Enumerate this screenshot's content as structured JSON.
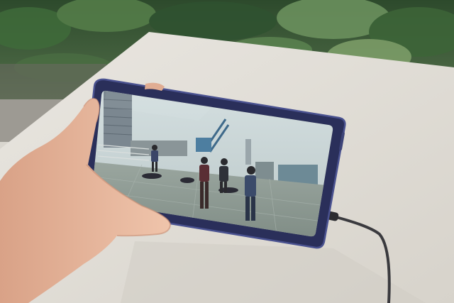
{
  "photo": {
    "subject": "hand-holding-smartphone-playing-video",
    "colors": {
      "foliage_dark": "#1f3a22",
      "foliage_mid": "#3f6b3a",
      "foliage_light": "#7fa06a",
      "table": "#e4e1db",
      "table_shadow": "#c9c5bd",
      "phone_frame": "#2a2f5a",
      "phone_edge": "#4a5290",
      "sky": "#c9d6d8",
      "rooftop": "#8f9c95",
      "skin": "#e8b9a0",
      "skin_shadow": "#c98f74",
      "cable": "#3a3a3e"
    }
  },
  "phone_screen": {
    "content": "video-frame-rooftop-scene"
  }
}
